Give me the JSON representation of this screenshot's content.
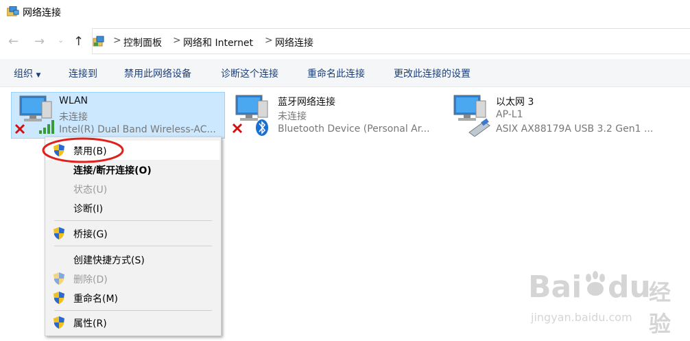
{
  "window": {
    "title": "网络连接",
    "icon": "network-folder-icon"
  },
  "nav": {
    "back_icon": "back-arrow-icon",
    "forward_icon": "forward-arrow-icon",
    "recent_icon": "chevron-down-icon",
    "up_icon": "up-arrow-icon"
  },
  "breadcrumb": {
    "items": [
      "控制面板",
      "网络和 Internet",
      "网络连接"
    ],
    "separator": ">"
  },
  "toolbar": {
    "organize": "组织",
    "connect_to": "连接到",
    "disable_device": "禁用此网络设备",
    "diagnose": "诊断这个连接",
    "rename": "重命名此连接",
    "change_settings": "更改此连接的设置"
  },
  "connections": [
    {
      "name": "WLAN",
      "status": "未连接",
      "device": "Intel(R) Dual Band Wireless-AC...",
      "icon": "wifi-adapter-icon",
      "selected": true
    },
    {
      "name": "蓝牙网络连接",
      "status": "未连接",
      "device": "Bluetooth Device (Personal Ar...",
      "icon": "bluetooth-adapter-icon",
      "selected": false
    },
    {
      "name": "以太网 3",
      "status": "AP-L1",
      "device": "ASIX AX88179A USB 3.2 Gen1 ...",
      "icon": "ethernet-adapter-icon",
      "selected": false
    }
  ],
  "context_menu": {
    "items": [
      {
        "label": "禁用(B)",
        "shield": true,
        "enabled": true,
        "bold": false,
        "highlighted": true
      },
      {
        "label": "连接/断开连接(O)",
        "shield": false,
        "enabled": true,
        "bold": true
      },
      {
        "label": "状态(U)",
        "shield": false,
        "enabled": false
      },
      {
        "label": "诊断(I)",
        "shield": false,
        "enabled": true
      },
      {
        "label": "桥接(G)",
        "shield": true,
        "enabled": true
      },
      {
        "label": "创建快捷方式(S)",
        "shield": false,
        "enabled": true
      },
      {
        "label": "删除(D)",
        "shield": true,
        "enabled": false
      },
      {
        "label": "重命名(M)",
        "shield": true,
        "enabled": true
      },
      {
        "label": "属性(R)",
        "shield": true,
        "enabled": true
      }
    ]
  },
  "watermark": {
    "brand": "Bai",
    "brand2": "du",
    "text": "经验",
    "url": "jingyan.baidu.com"
  },
  "colors": {
    "selection": "#cce8ff",
    "selection_border": "#99d1ff",
    "toolbar_text": "#1a3f7a",
    "annotation_red": "#e0201b"
  }
}
